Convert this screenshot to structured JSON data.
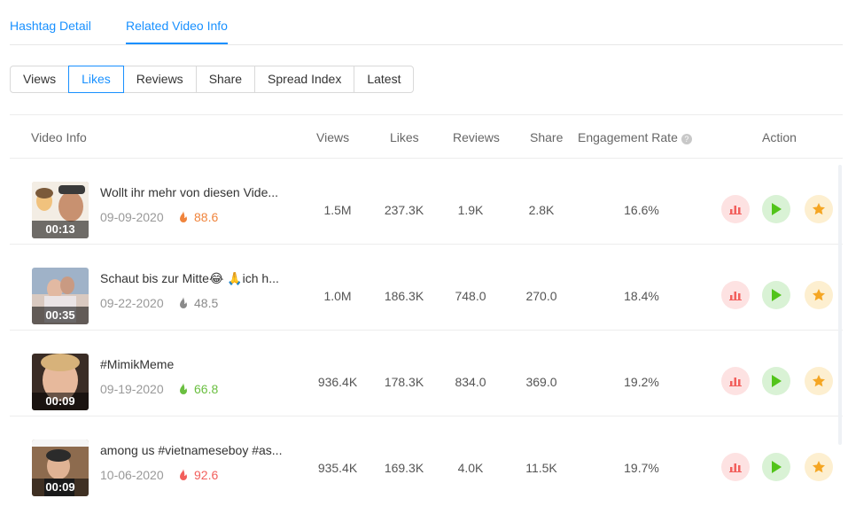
{
  "tabs": [
    {
      "label": "Hashtag Detail"
    },
    {
      "label": "Related Video Info"
    }
  ],
  "sort_options": [
    {
      "label": "Views"
    },
    {
      "label": "Likes"
    },
    {
      "label": "Reviews"
    },
    {
      "label": "Share"
    },
    {
      "label": "Spread Index"
    },
    {
      "label": "Latest"
    }
  ],
  "table": {
    "headers": {
      "video_info": "Video Info",
      "views": "Views",
      "likes": "Likes",
      "reviews": "Reviews",
      "share": "Share",
      "engagement_rate": "Engagement Rate",
      "action": "Action"
    },
    "rows": [
      {
        "title": "Wollt ihr mehr von diesen Vide...",
        "date": "09-09-2020",
        "score": "88.6",
        "duration": "00:13",
        "views": "1.5M",
        "likes": "237.3K",
        "reviews": "1.9K",
        "share": "2.8K",
        "engagement": "16.6%"
      },
      {
        "title": "Schaut bis zur Mitte😂 🙏ich h...",
        "date": "09-22-2020",
        "score": "48.5",
        "duration": "00:35",
        "views": "1.0M",
        "likes": "186.3K",
        "reviews": "748.0",
        "share": "270.0",
        "engagement": "18.4%"
      },
      {
        "title": "#MimikMeme",
        "date": "09-19-2020",
        "score": "66.8",
        "duration": "00:09",
        "views": "936.4K",
        "likes": "178.3K",
        "reviews": "834.0",
        "share": "369.0",
        "engagement": "19.2%"
      },
      {
        "title": "among us #vietnameseboy #as...",
        "date": "10-06-2020",
        "score": "92.6",
        "duration": "00:09",
        "views": "935.4K",
        "likes": "169.3K",
        "reviews": "4.0K",
        "share": "11.5K",
        "engagement": "19.7%"
      }
    ]
  },
  "colors": {
    "accent": "#1890ff",
    "score_row1": "#f0843c",
    "score_row2": "#8a8a8a",
    "score_row3": "#6abf40",
    "score_row4": "#f25f5c",
    "action_stats": "#f25f5c",
    "action_play": "#52c41a",
    "action_star": "#f5a623"
  },
  "icons": {
    "fire": "fire-icon",
    "info": "info-circle-icon",
    "stats": "bar-chart-icon",
    "play": "play-icon",
    "star": "star-icon"
  }
}
